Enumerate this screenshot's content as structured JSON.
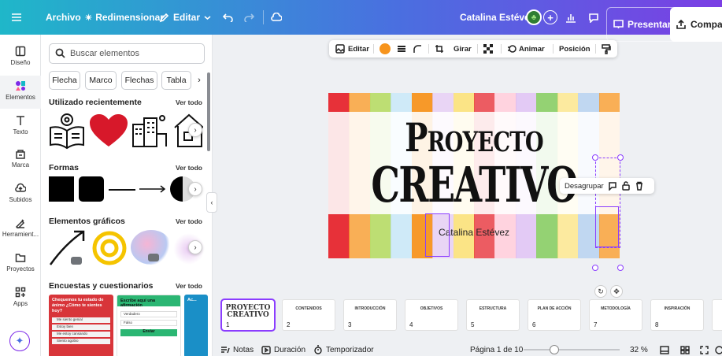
{
  "topbar": {
    "menu_icon": "hamburger-icon",
    "archivo": "Archivo",
    "redimensionar": "Redimensionar",
    "editar": "Editar",
    "user_name": "Catalina Estévez",
    "presentar": "Presentar",
    "compartir": "Compartir"
  },
  "rail": {
    "items": [
      {
        "label": "Diseño",
        "icon": "layout-icon"
      },
      {
        "label": "Elementos",
        "icon": "elements-icon"
      },
      {
        "label": "Texto",
        "icon": "text-icon"
      },
      {
        "label": "Marca",
        "icon": "brand-icon"
      },
      {
        "label": "Subidos",
        "icon": "upload-icon"
      },
      {
        "label": "Herramient...",
        "icon": "tools-icon"
      },
      {
        "label": "Proyectos",
        "icon": "folder-icon"
      },
      {
        "label": "Apps",
        "icon": "apps-icon"
      }
    ]
  },
  "panel": {
    "search_placeholder": "Buscar elementos",
    "chips": [
      "Flecha",
      "Marco",
      "Flechas",
      "Tabla"
    ],
    "recent_title": "Utilizado recientemente",
    "shapes_title": "Formas",
    "graphics_title": "Elementos gráficos",
    "surveys_title": "Encuestas y cuestionarios",
    "see_all": "Ver todo",
    "survey1": {
      "title": "Chequemos tu estado de ánimo ¿Cómo te sientes hoy?",
      "options": [
        "Me siento genial",
        "Estoy bien",
        "Me estoy cansando",
        "Siento agobio"
      ]
    },
    "survey2": {
      "title": "Escribe aquí una afirmación",
      "f1": "Verdadero",
      "f2": "Falso",
      "button": "Enviar"
    },
    "survey3": {
      "title": "Ac..."
    }
  },
  "toolbar": {
    "editar": "Editar",
    "color": "#f7941d",
    "girar": "Girar",
    "animar": "Animar",
    "posicion": "Posición"
  },
  "slide": {
    "title_line1": "Proyecto",
    "title_line2": "CREATIVO",
    "author": "Catalina Estévez",
    "stripe_colors": [
      "#e6262e",
      "#f7941d",
      "#b9dc6b",
      "#bfe3f5",
      "#f7941d",
      "#e2c7f2",
      "#fbe37f",
      "#e6262e",
      "#ffd1dd",
      "#d9b8f2",
      "#8ed06b",
      "#fbe37f",
      "#bdd5f0",
      "#f7941d"
    ]
  },
  "context_menu": {
    "desagrupar": "Desagrupar"
  },
  "thumbnails": [
    {
      "num": "1",
      "title": "PROYECTO CREATIVO"
    },
    {
      "num": "2",
      "title": "CONTENIDOS"
    },
    {
      "num": "3",
      "title": "INTRODUCCIÓN"
    },
    {
      "num": "4",
      "title": "OBJETIVOS"
    },
    {
      "num": "5",
      "title": "ESTRUCTURA"
    },
    {
      "num": "6",
      "title": "PLAN DE ACCIÓN"
    },
    {
      "num": "7",
      "title": "METODOLOGÍA"
    },
    {
      "num": "8",
      "title": "INSPIRACIÓN"
    }
  ],
  "status": {
    "notas": "Notas",
    "duracion": "Duración",
    "temporizador": "Temporizador",
    "page": "Página 1 de 10",
    "zoom": "32 %",
    "zoom_level": 0.32
  }
}
